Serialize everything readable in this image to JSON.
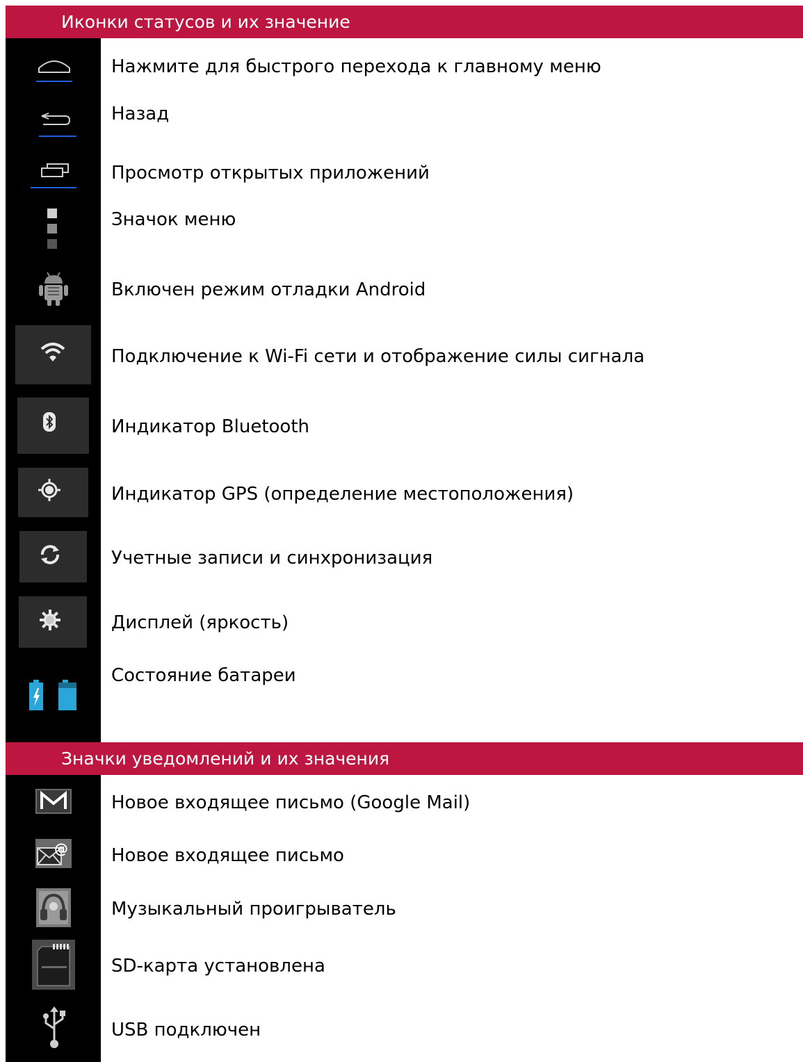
{
  "colors": {
    "accent": "#bd1640",
    "icon_bg": "#2c2c2c",
    "nav_blue": "#1f5fe0",
    "battery_blue": "#2aa6d8"
  },
  "section_status": {
    "title": "Иконки статусов и их значение",
    "items": [
      {
        "icon": "home-icon",
        "label": "Нажмите для быстрого перехода к главному меню"
      },
      {
        "icon": "back-icon",
        "label": "Назад"
      },
      {
        "icon": "recent-apps-icon",
        "label": "Просмотр открытых приложений"
      },
      {
        "icon": "menu-icon",
        "label": "Значок меню"
      },
      {
        "icon": "android-debug-icon",
        "label": "Включен режим отладки Android"
      },
      {
        "icon": "wifi-icon",
        "label": "Подключение к Wi-Fi сети и отображение силы сигнала"
      },
      {
        "icon": "bluetooth-icon",
        "label": "Индикатор Bluetooth"
      },
      {
        "icon": "gps-icon",
        "label": "Индикатор GPS (определение местоположения)"
      },
      {
        "icon": "sync-icon",
        "label": "Учетные записи и синхронизация"
      },
      {
        "icon": "brightness-icon",
        "label": "Дисплей (яркость)"
      },
      {
        "icon": "battery-icon",
        "label": "Состояние батареи"
      }
    ]
  },
  "section_notifications": {
    "title": "Значки уведомлений и их значения",
    "items": [
      {
        "icon": "gmail-icon",
        "label": "Новое входящее письмо (Google Mail)"
      },
      {
        "icon": "email-icon",
        "label": "Новое входящее письмо"
      },
      {
        "icon": "music-player-icon",
        "label": "Музыкальный проигрыватель"
      },
      {
        "icon": "sd-card-icon",
        "label": "SD-карта установлена"
      },
      {
        "icon": "usb-icon",
        "label": "USB подключен"
      }
    ]
  }
}
